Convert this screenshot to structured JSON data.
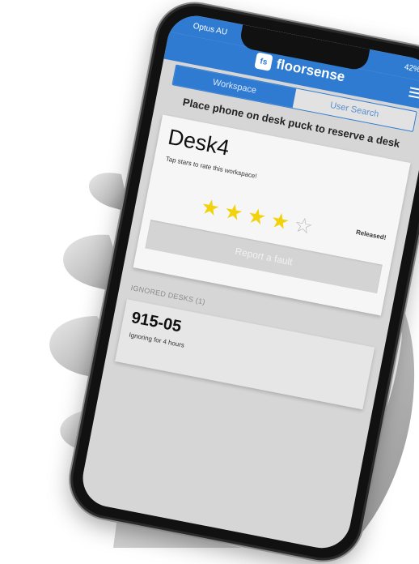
{
  "status": {
    "carrier": "Optus AU",
    "battery": "42%"
  },
  "header": {
    "logo_mark": "fs",
    "app_name": "floorsense"
  },
  "tabs": [
    {
      "label": "Workspace",
      "active": true
    },
    {
      "label": "User Search",
      "active": false
    }
  ],
  "main": {
    "instruction": "Place phone on desk puck to reserve a desk",
    "desk": {
      "name": "Desk4",
      "rate_hint": "Tap stars to rate this workspace!",
      "status": "Released!",
      "rating": 4,
      "rating_max": 5,
      "fault_label": "Report a fault"
    },
    "ignored": {
      "title": "IGNORED DESKS (1)",
      "items": [
        {
          "desk": "915-05",
          "note": "Ignoring for 4 hours"
        }
      ]
    }
  },
  "colors": {
    "brand": "#2f7bd2",
    "star": "#f2d20a"
  }
}
